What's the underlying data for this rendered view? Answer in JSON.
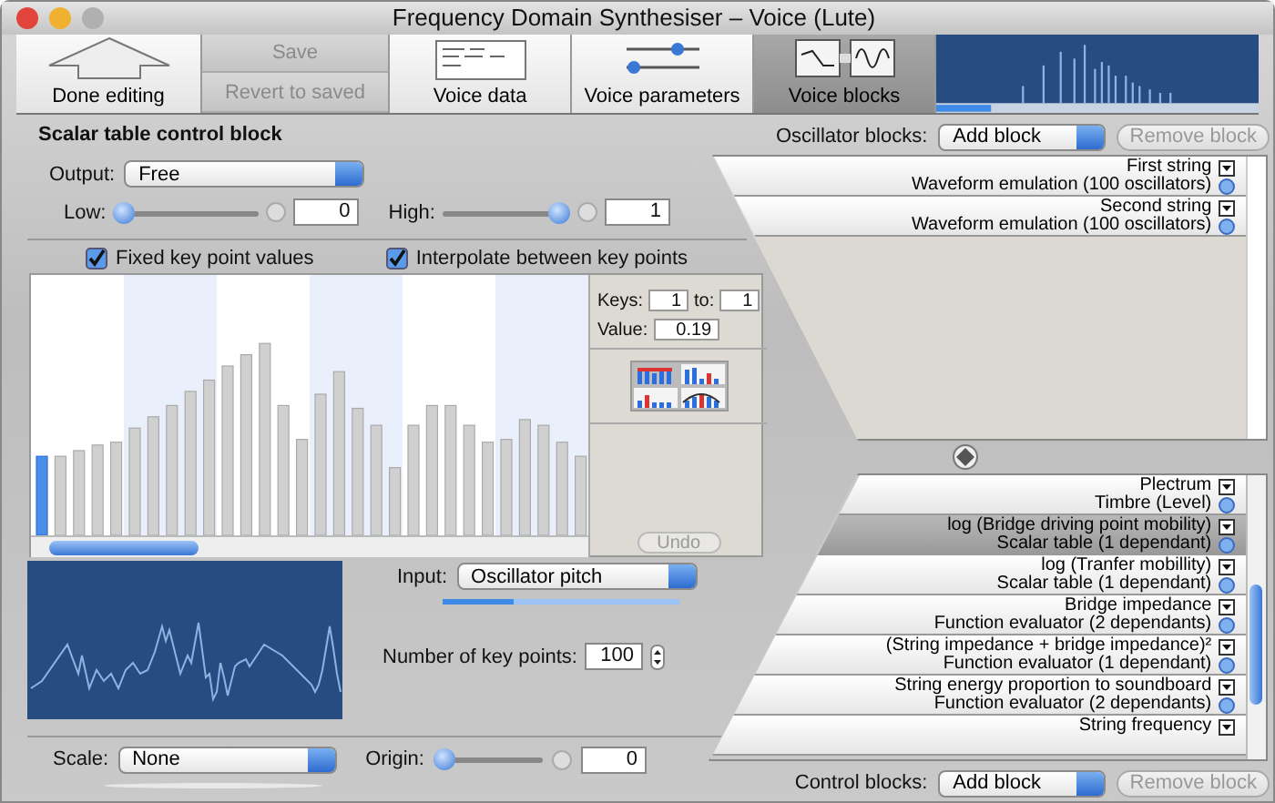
{
  "window": {
    "title": "Frequency Domain Synthesiser – Voice (Lute)"
  },
  "toolbar": [
    {
      "kind": "arrow",
      "label": "Done editing",
      "selected": false
    },
    {
      "kind": "stack",
      "buttons": [
        {
          "label": "Save",
          "disabled": true
        },
        {
          "label": "Revert to saved",
          "disabled": true
        }
      ]
    },
    {
      "kind": "document",
      "label": "Voice data",
      "selected": false
    },
    {
      "kind": "sliders",
      "label": "Voice parameters",
      "selected": false
    },
    {
      "kind": "blocks",
      "label": "Voice blocks",
      "selected": true
    }
  ],
  "control_block": {
    "title": "Scalar table control block",
    "output": {
      "label": "Output:",
      "value": "Free"
    },
    "low": {
      "label": "Low:",
      "level": 0,
      "value": "0"
    },
    "high": {
      "label": "High:",
      "level": 1,
      "value": "1"
    },
    "options": [
      {
        "label": "Fixed key point values",
        "checked": true
      },
      {
        "label": "Interpolate between key points",
        "checked": true
      }
    ],
    "editor": {
      "keys_label": "Keys:",
      "keys_from": "1",
      "to_label": "to:",
      "keys_to": "1",
      "value_label": "Value:",
      "value": "0.19",
      "tools": [
        {
          "kind": "set",
          "selected": true
        },
        {
          "kind": "scale",
          "selected": false
        },
        {
          "kind": "lower",
          "selected": false
        },
        {
          "kind": "curve",
          "selected": false
        }
      ],
      "undo": {
        "label": "Undo",
        "disabled": true
      }
    },
    "input": {
      "label": "Input:",
      "value": "Oscillator pitch",
      "level": 0.3
    },
    "key_points": {
      "label": "Number of key points:",
      "value": "100"
    },
    "scale": {
      "label": "Scale:",
      "value": "None"
    },
    "origin": {
      "label": "Origin:",
      "level": 0,
      "value": "0"
    }
  },
  "oscillator_blocks": {
    "label": "Oscillator blocks:",
    "add": "Add block",
    "remove": {
      "label": "Remove block",
      "disabled": true
    },
    "items": [
      {
        "name": "First string",
        "type": "Waveform emulation (100 oscillators)",
        "selected": false
      },
      {
        "name": "Second string",
        "type": "Waveform emulation (100 oscillators)",
        "selected": false
      }
    ]
  },
  "control_blocks": {
    "label": "Control blocks:",
    "add": "Add block",
    "remove": {
      "label": "Remove block",
      "disabled": true
    },
    "items": [
      {
        "name": "Plectrum",
        "type": "Timbre (Level)",
        "selected": false
      },
      {
        "name": "log (Bridge driving point mobility)",
        "type": "Scalar table (1 dependant)",
        "selected": true
      },
      {
        "name": "log (Tranfer mobillity)",
        "type": "Scalar table (1 dependant)",
        "selected": false
      },
      {
        "name": "Bridge impedance",
        "type": "Function evaluator (2 dependants)",
        "selected": false
      },
      {
        "name": "(String impedance + bridge impedance)²",
        "type": "Function evaluator (1 dependant)",
        "selected": false
      },
      {
        "name": "String energy proportion to soundboard",
        "type": "Function evaluator (2 dependants)",
        "selected": false
      },
      {
        "name": "String frequency",
        "selected": false
      }
    ]
  }
}
